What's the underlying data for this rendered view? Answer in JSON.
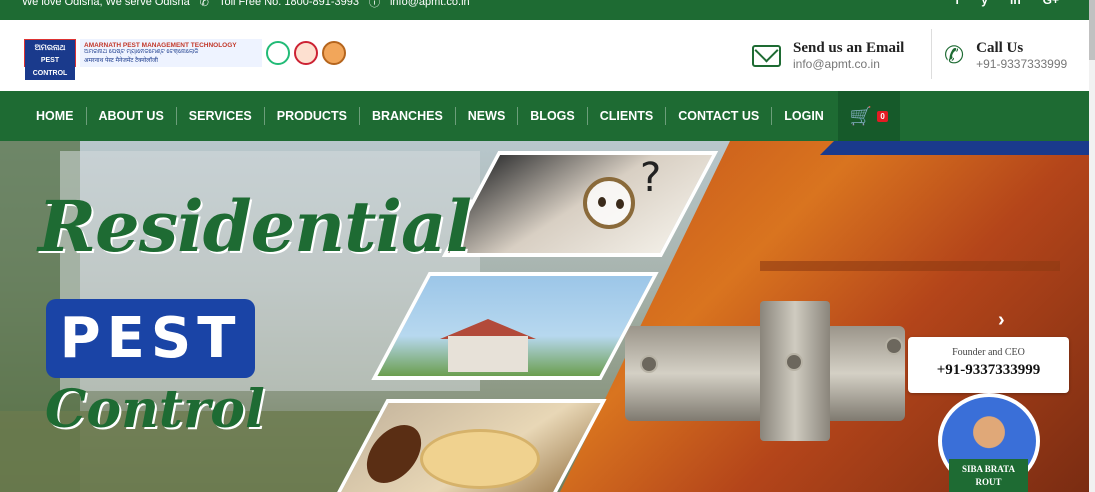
{
  "topbar": {
    "tagline": "We love Odisha, We serve Odisha",
    "toll_free": "Toll Free No. 1800-891-3993",
    "email": "info@apmt.co.in",
    "social": [
      "f",
      "y",
      "in",
      "G+"
    ]
  },
  "logo": {
    "badge_text": "ଅମରନାଥ",
    "badge_sub": "PEST CONTROL",
    "line1": "AMARNATH PEST MANAGEMENT TECHNOLOGY",
    "line2": "ଅମରନାଥ ପେଷ୍ଟ ମ୍ୟାନେଜମେଣ୍ଟ ଟେକ୍ନୋଲୋଜି",
    "line3": "अमरनाथ पेस्ट मैनेजमेंट टैक्नोलॉजी"
  },
  "header": {
    "email_title": "Send us an Email",
    "email_value": "info@apmt.co.in",
    "call_title": "Call Us",
    "call_value": "+91-9337333999"
  },
  "nav": {
    "items": [
      "HOME",
      "ABOUT US",
      "SERVICES",
      "PRODUCTS",
      "BRANCHES",
      "NEWS",
      "BLOGS",
      "CLIENTS",
      "CONTACT US",
      "LOGIN"
    ],
    "cart_count": "0"
  },
  "hero": {
    "word1": "Residential",
    "word2": "PEST",
    "word3": "Control",
    "question_mark": "?",
    "next_arrow": "›"
  },
  "ceo": {
    "role": "Founder and CEO",
    "phone": "+91-9337333999",
    "name_line1": "SIBA BRATA",
    "name_line2": "ROUT"
  },
  "colors": {
    "brand_green": "#1e6b33",
    "brand_blue": "#1a44a6",
    "cart_badge": "#e31b23"
  },
  "icons": [
    "phone-icon",
    "info-icon",
    "mail-icon",
    "cart-icon",
    "chevron-right-icon"
  ]
}
